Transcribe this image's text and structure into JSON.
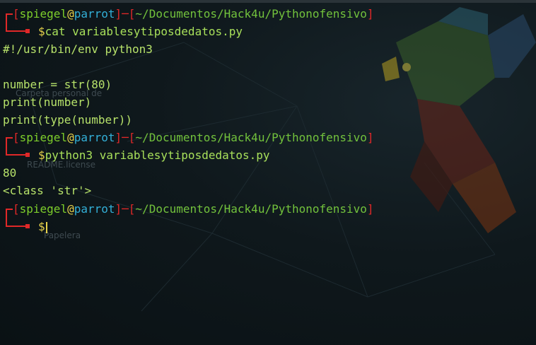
{
  "colors": {
    "bracket": "#e02828",
    "user": "#7ecf2b",
    "at": "#e7d24b",
    "host": "#33b0d8",
    "path": "#72c23c",
    "text": "#a8e05a"
  },
  "prompt": {
    "user": "spiegel",
    "at": "@",
    "host": "parrot",
    "path": "~/Documentos/Hack4u/Pythonofensivo",
    "dollar": "$"
  },
  "commands": [
    "cat variablesytiposdedatos.py",
    "python3 variablesytiposdedatos.py",
    ""
  ],
  "file_lines": [
    "#!/usr/bin/env python3",
    "",
    "number = str(80)",
    "print(number)",
    "print(type(number))"
  ],
  "output_lines": [
    "80",
    "<class 'str'>"
  ],
  "desktop_labels": {
    "folder": "Carpeta personal de",
    "readme": "README.license",
    "trash": "Papelera"
  }
}
